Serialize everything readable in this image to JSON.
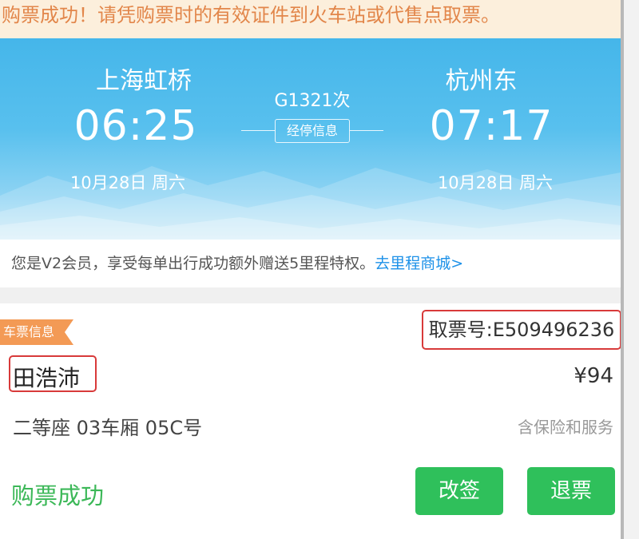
{
  "notice": "购票成功！请凭购票时的有效证件到火车站或代售点取票。",
  "trip": {
    "from_station": "上海虹桥",
    "depart_time": "06:25",
    "depart_date": "10月28日 周六",
    "train_no": "G1321次",
    "stops_label": "经停信息",
    "to_station": "杭州东",
    "arrive_time": "07:17",
    "arrive_date": "10月28日 周六"
  },
  "member": {
    "text": "您是V2会员，享受每单出行成功额外赠送5里程特权。",
    "link": "去里程商城>"
  },
  "ticket": {
    "tag": "车票信息",
    "pickup_no": "取票号:E509496236",
    "passenger": "田浩沛",
    "price": "¥94",
    "seat": "二等座  03车厢 05C号",
    "insurance": "含保险和服务",
    "status": "购票成功",
    "change_label": "改签",
    "refund_label": "退票"
  },
  "colors": {
    "accent_green": "#2fc05b",
    "link_blue": "#1d91e8",
    "notice_orange": "#e2864a",
    "highlight_red": "#d83a3a"
  }
}
